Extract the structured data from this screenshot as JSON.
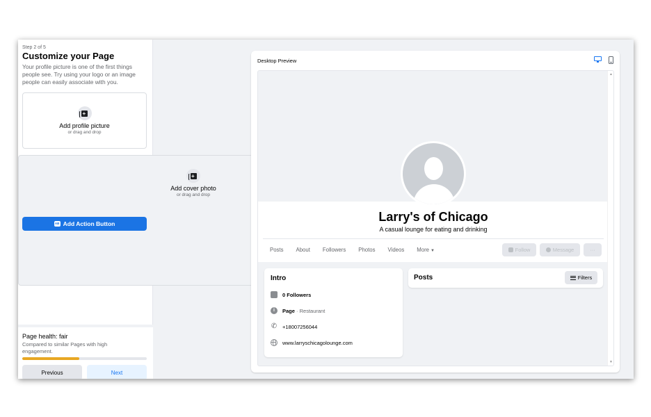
{
  "sidebar": {
    "step": "Step 2 of 5",
    "title": "Customize your Page",
    "description": "Your profile picture is one of the first things people see. Try using your logo or an image people can easily associate with you.",
    "profile_upload": {
      "label": "Add profile picture",
      "sub": "or drag and drop",
      "icon": "add-photo-icon"
    },
    "cover_upload": {
      "label": "Add cover photo",
      "sub": "or drag and drop",
      "icon": "add-photo-icon"
    },
    "action_button": {
      "label": "Add Action Button",
      "icon_text": "AB"
    },
    "health": {
      "title": "Page health: fair",
      "description": "Compared to similar Pages with high engagement.",
      "progress_percent": 46,
      "progress_color": "#e8a723"
    },
    "previous_label": "Previous",
    "next_label": "Next"
  },
  "preview": {
    "title": "Desktop Preview",
    "views": [
      "desktop",
      "mobile"
    ],
    "active_view": "desktop",
    "page": {
      "name": "Larry's of Chicago",
      "category": "A casual lounge for eating and drinking",
      "tabs": [
        "Posts",
        "About",
        "Followers",
        "Photos",
        "Videos",
        "More"
      ],
      "actions": {
        "follow": "Follow",
        "message": "Message",
        "more": "···"
      },
      "intro": {
        "title": "Intro",
        "followers": "0 Followers",
        "page_type_label": "Page",
        "page_type_value": " · Restaurant",
        "phone": "+18007256044",
        "website": "www.larryschicagolounge.com"
      },
      "posts": {
        "title": "Posts",
        "filters_label": "Filters"
      }
    }
  },
  "colors": {
    "accent": "#1b74e4",
    "background": "#f0f2f5"
  }
}
